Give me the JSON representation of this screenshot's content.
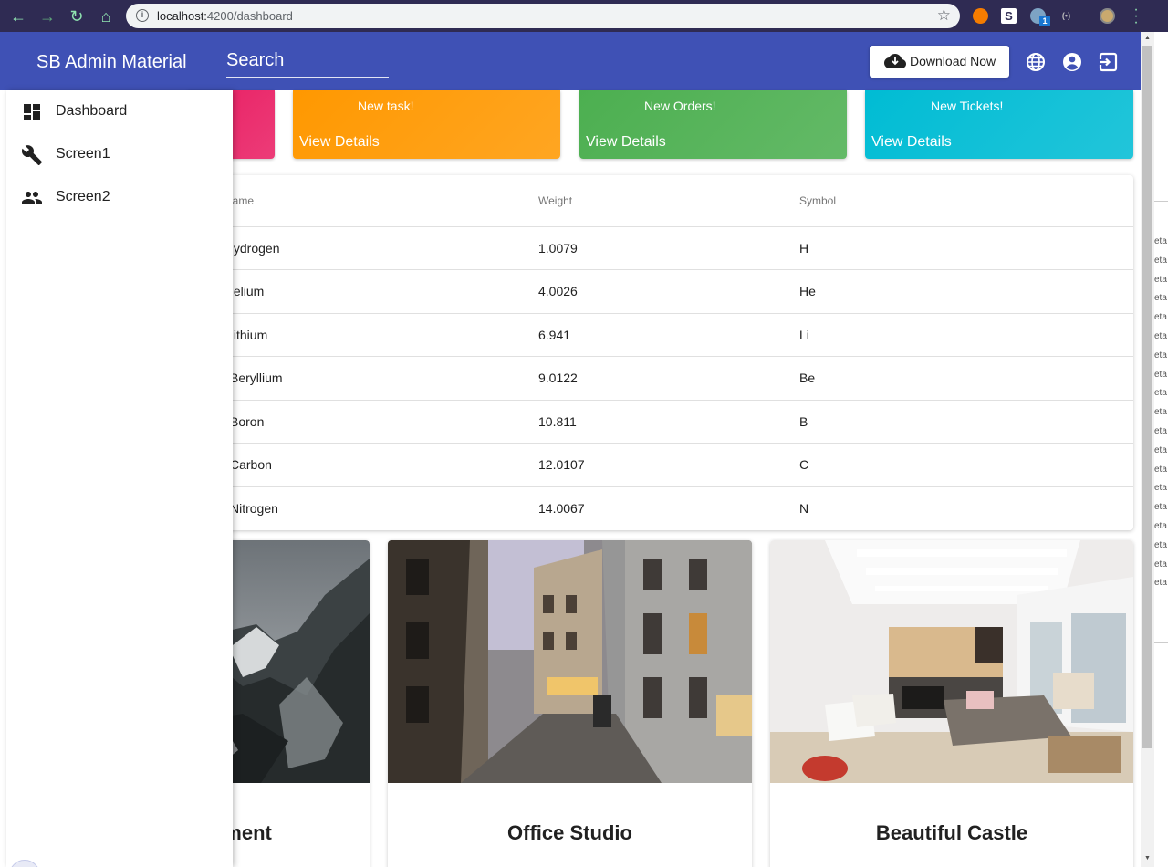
{
  "browser": {
    "url_host": "localhost:",
    "url_path": "4200/dashboard",
    "back_icon": "arrow-left-icon",
    "forward_icon": "arrow-right-icon",
    "reload_icon": "reload-icon",
    "home_icon": "home-icon",
    "bookmark_icon": "star-icon",
    "extension_badge": "1"
  },
  "header": {
    "brand": "SB Admin Material",
    "search_placeholder": "Search",
    "download_label": "Download Now",
    "icons": [
      "globe-icon",
      "account-circle-icon",
      "logout-icon"
    ],
    "color": "#3f51b5"
  },
  "sidebar": {
    "items": [
      {
        "label": "Dashboard",
        "icon": "dashboard-icon"
      },
      {
        "label": "Screen1",
        "icon": "wrench-icon"
      },
      {
        "label": "Screen2",
        "icon": "people-icon"
      }
    ]
  },
  "stat_cards": [
    {
      "title": "",
      "details": "",
      "color": "#e91e63"
    },
    {
      "title": "New task!",
      "details": "View Details",
      "color": "#ff9800"
    },
    {
      "title": "New Orders!",
      "details": "View Details",
      "color": "#4caf50"
    },
    {
      "title": "New Tickets!",
      "details": "View Details",
      "color": "#00bcd4"
    }
  ],
  "table": {
    "headers": [
      "lame",
      "Weight",
      "Symbol"
    ],
    "rows": [
      [
        "Iydrogen",
        "1.0079",
        "H"
      ],
      [
        "Ielium",
        "4.0026",
        "He"
      ],
      [
        ".ithium",
        "6.941",
        "Li"
      ],
      [
        "Beryllium",
        "9.0122",
        "Be"
      ],
      [
        "Boron",
        "10.811",
        "B"
      ],
      [
        "Carbon",
        "12.0107",
        "C"
      ],
      [
        "Nitrogen",
        "14.0067",
        "N"
      ]
    ]
  },
  "image_cards": [
    {
      "caption": "artment",
      "scene": "mountain"
    },
    {
      "caption": "Office Studio",
      "scene": "street"
    },
    {
      "caption": "Beautiful Castle",
      "scene": "living-room"
    }
  ],
  "edge_panel_text": "eta"
}
